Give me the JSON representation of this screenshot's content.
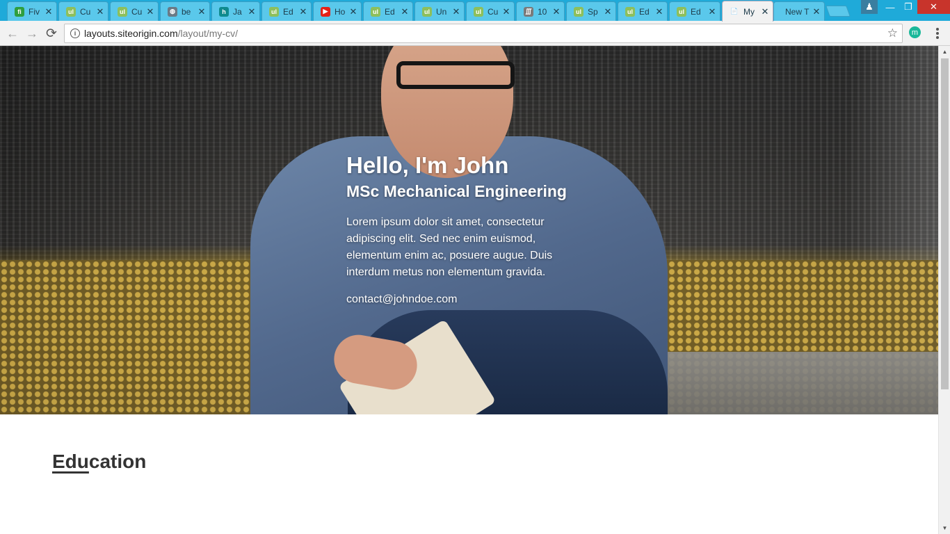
{
  "tabs": [
    {
      "title": "Fiv",
      "fav_color": "#2e9e3e",
      "fav_glyph": "fi"
    },
    {
      "title": "Cu",
      "fav_color": "#8dbf5c",
      "fav_glyph": "ul"
    },
    {
      "title": "Cu",
      "fav_color": "#8dbf5c",
      "fav_glyph": "ul"
    },
    {
      "title": "be",
      "fav_color": "#6a7a86",
      "fav_glyph": "◍"
    },
    {
      "title": "Ja",
      "fav_color": "#0f8a8e",
      "fav_glyph": "h"
    },
    {
      "title": "Ed",
      "fav_color": "#8dbf5c",
      "fav_glyph": "ul"
    },
    {
      "title": "Ho",
      "fav_color": "#e62117",
      "fav_glyph": "▶"
    },
    {
      "title": "Ed",
      "fav_color": "#8dbf5c",
      "fav_glyph": "ul"
    },
    {
      "title": "Un",
      "fav_color": "#8dbf5c",
      "fav_glyph": "ul"
    },
    {
      "title": "Cu",
      "fav_color": "#8dbf5c",
      "fav_glyph": "ul"
    },
    {
      "title": "10",
      "fav_color": "#7a7a7a",
      "fav_glyph": "∭"
    },
    {
      "title": "Sp",
      "fav_color": "#8dbf5c",
      "fav_glyph": "ul"
    },
    {
      "title": "Ed",
      "fav_color": "#8dbf5c",
      "fav_glyph": "ul"
    },
    {
      "title": "Ed",
      "fav_color": "#8dbf5c",
      "fav_glyph": "ul"
    },
    {
      "title": "My",
      "fav_color": "#ffffff",
      "fav_glyph": "📄",
      "active": true
    },
    {
      "title": "New T",
      "fav_color": "",
      "fav_glyph": ""
    }
  ],
  "address": {
    "host": "layouts.siteorigin.com",
    "path": "/layout/my-cv/"
  },
  "extension": {
    "glyph": "m",
    "color": "#1bb89a"
  },
  "hero": {
    "title": "Hello, I'm John",
    "subtitle": "MSc Mechanical Engineering",
    "body": "Lorem ipsum dolor sit amet, consectetur adipiscing elit. Sed nec enim euismod, elementum enim ac, posuere augue. Duis interdum metus non elementum gravida.",
    "email": "contact@johndoe.com"
  },
  "section": {
    "heading_underlined": "Edu",
    "heading_rest": "cation"
  }
}
